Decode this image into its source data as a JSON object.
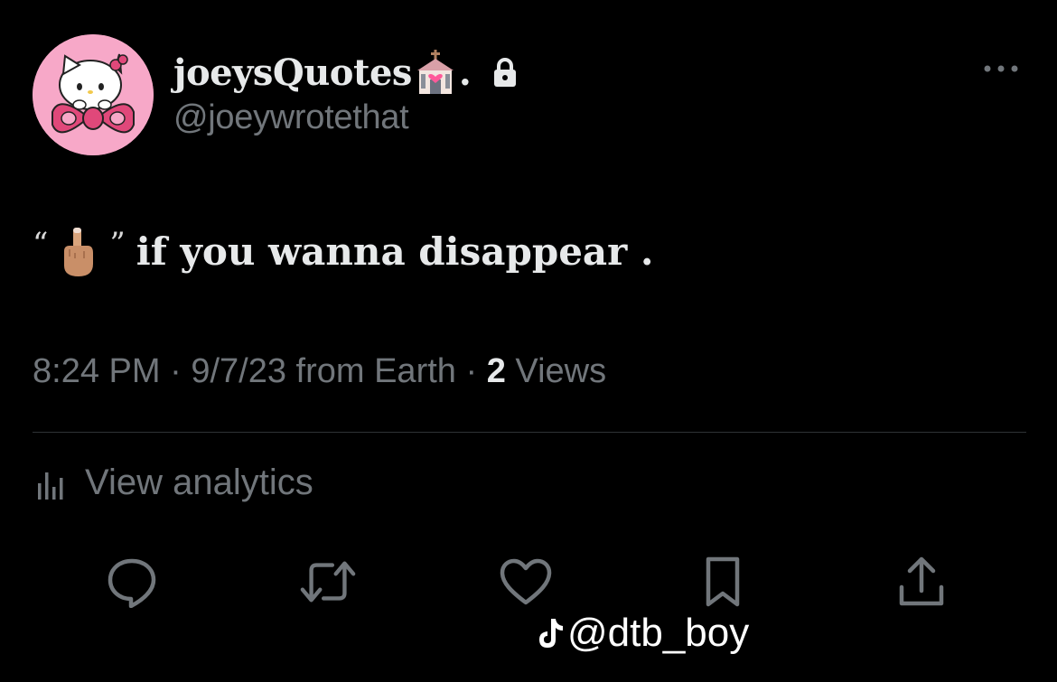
{
  "tweet": {
    "display_name": "joeysQuotes",
    "name_suffix": ".",
    "handle": "@joeywrotethat",
    "text": "if you wanna disappear .",
    "quote_open": "“",
    "quote_close": "”",
    "time": "8:24 PM",
    "date": "9/7/23",
    "source": "from Earth",
    "views_count": "2",
    "views_label": "Views",
    "analytics_label": "View analytics"
  },
  "icons": {
    "avatar": "hello-kitty-avatar",
    "name_emoji": "wedding-chapel-emoji",
    "verified_lock": "lock-icon",
    "more": "more-icon",
    "hand_emoji": "middle-finger-emoji",
    "analytics": "analytics-icon",
    "actions": [
      "reply-icon",
      "retweet-icon",
      "like-icon",
      "bookmark-icon",
      "share-icon"
    ]
  },
  "watermark": {
    "text": "@dtb_boy"
  },
  "colors": {
    "background": "#000000",
    "text_primary": "#e7e9ea",
    "text_secondary": "#71767b",
    "divider": "#2f3336",
    "avatar_bg": "#f7a8c8"
  }
}
